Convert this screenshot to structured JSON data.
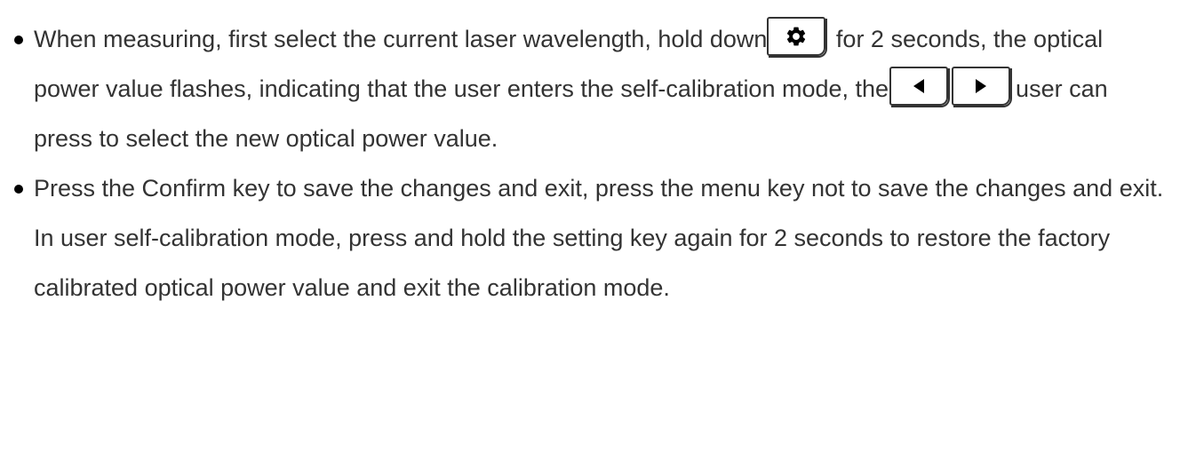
{
  "bullets": [
    {
      "p1": "When measuring, first select the current laser wavelength, hold down",
      "p2": " for 2 seconds, the optical power value flashes, indicating that the user enters the self-calibration mode, the",
      "p3": "user can press to select the new optical power value."
    },
    {
      "text": "Press the Confirm key to save the changes and exit, press the menu key not to save the changes and exit. In user self-calibration mode, press and hold the setting key again for 2 seconds to restore the factory calibrated optical power value and exit the calibration mode."
    }
  ],
  "icons": {
    "settings_key": "gear-icon",
    "left_key": "triangle-left-icon",
    "right_key": "triangle-right-icon"
  },
  "colors": {
    "text": "#333333",
    "key_border": "#333333",
    "icon": "#000000"
  }
}
